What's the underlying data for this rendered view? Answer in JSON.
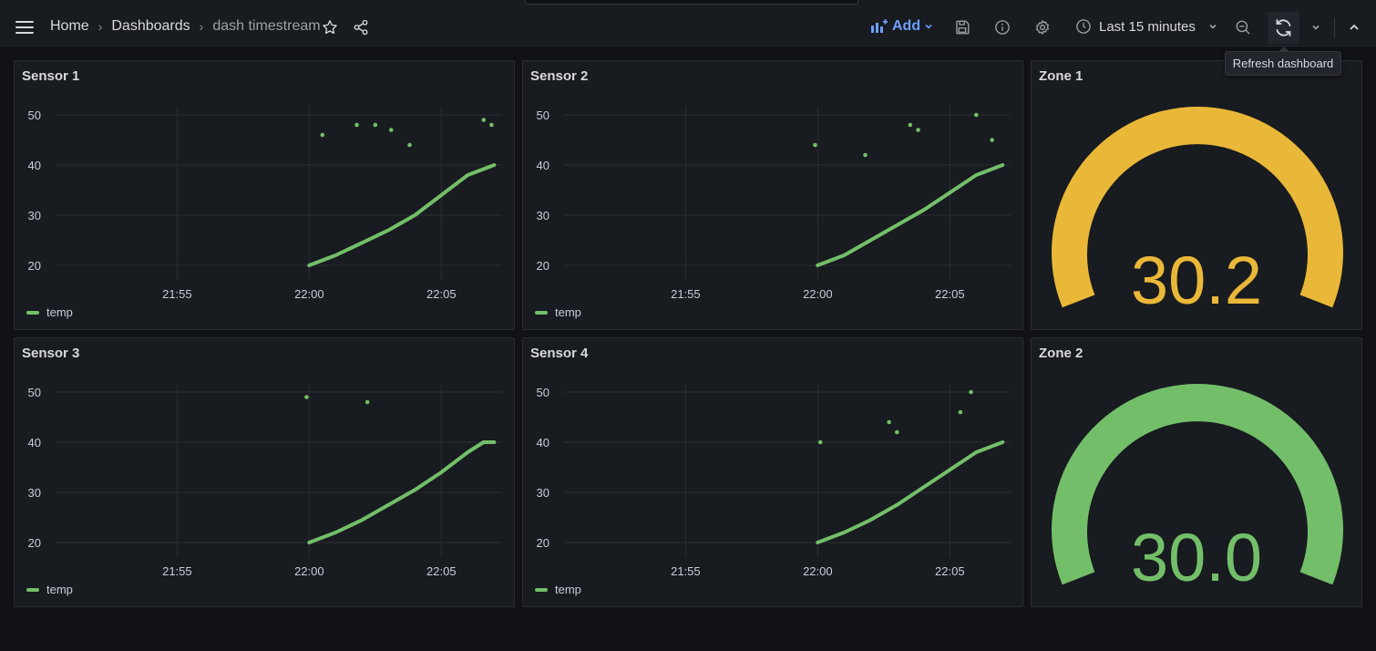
{
  "breadcrumbs": [
    "Home",
    "Dashboards",
    "dash timestream"
  ],
  "toolbar": {
    "add_label": "Add",
    "time_range": "Last 15 minutes",
    "refresh_tooltip": "Refresh dashboard"
  },
  "colors": {
    "series": "#73bf69",
    "gauge_zone1": "#eab839",
    "gauge_zone2": "#73bf69",
    "accent": "#6e9fff"
  },
  "icons": [
    "menu-icon",
    "star-icon",
    "share-icon",
    "add-panel-icon",
    "save-icon",
    "info-icon",
    "gear-icon",
    "clock-icon",
    "chevron-down-icon",
    "zoom-out-icon",
    "refresh-icon",
    "collapse-icon"
  ],
  "panels": [
    {
      "title": "Sensor 1",
      "legend": "temp"
    },
    {
      "title": "Sensor 2",
      "legend": "temp"
    },
    {
      "title": "Sensor 3",
      "legend": "temp"
    },
    {
      "title": "Sensor 4",
      "legend": "temp"
    }
  ],
  "gauges": [
    {
      "title": "Zone 1",
      "value": "30.2",
      "color": "#eab839"
    },
    {
      "title": "Zone 2",
      "value": "30.0",
      "color": "#73bf69"
    }
  ],
  "chart_data": [
    {
      "type": "scatter",
      "title": "Sensor 1",
      "series": [
        {
          "name": "temp",
          "line": [
            [
              "22:00",
              20
            ],
            [
              "22:01",
              22
            ],
            [
              "22:02",
              24.5
            ],
            [
              "22:03",
              27
            ],
            [
              "22:04",
              30
            ],
            [
              "22:05",
              34
            ],
            [
              "22:06",
              38
            ],
            [
              "22:07",
              40
            ]
          ],
          "points": [
            [
              "22:00.5",
              46
            ],
            [
              "22:01.8",
              48
            ],
            [
              "22:02.5",
              48
            ],
            [
              "22:03.1",
              47
            ],
            [
              "22:03.8",
              44
            ],
            [
              "22:06.6",
              49
            ],
            [
              "22:06.9",
              48
            ]
          ]
        }
      ],
      "x_ticks": [
        "21:55",
        "22:00",
        "22:05"
      ],
      "y_ticks": [
        20,
        30,
        40,
        50
      ],
      "ylim": [
        20,
        50
      ]
    },
    {
      "type": "scatter",
      "title": "Sensor 2",
      "series": [
        {
          "name": "temp",
          "line": [
            [
              "22:00",
              20
            ],
            [
              "22:01",
              22
            ],
            [
              "22:02",
              25
            ],
            [
              "22:03",
              28
            ],
            [
              "22:04",
              31
            ],
            [
              "22:05",
              34.5
            ],
            [
              "22:06",
              38
            ],
            [
              "22:07",
              40
            ]
          ],
          "points": [
            [
              "21:59.9",
              44
            ],
            [
              "22:01.8",
              42
            ],
            [
              "22:03.5",
              48
            ],
            [
              "22:03.8",
              47
            ],
            [
              "22:06",
              50
            ],
            [
              "22:06.6",
              45
            ]
          ]
        }
      ],
      "x_ticks": [
        "21:55",
        "22:00",
        "22:05"
      ],
      "y_ticks": [
        20,
        30,
        40,
        50
      ],
      "ylim": [
        20,
        50
      ]
    },
    {
      "type": "scatter",
      "title": "Sensor 3",
      "series": [
        {
          "name": "temp",
          "line": [
            [
              "22:00",
              20
            ],
            [
              "22:01",
              22
            ],
            [
              "22:02",
              24.5
            ],
            [
              "22:03",
              27.5
            ],
            [
              "22:04",
              30.5
            ],
            [
              "22:05",
              34
            ],
            [
              "22:06",
              38
            ],
            [
              "22:06.6",
              40
            ],
            [
              "22:07",
              40
            ]
          ],
          "points": [
            [
              "21:59.9",
              49
            ],
            [
              "22:02.2",
              48
            ]
          ]
        }
      ],
      "x_ticks": [
        "21:55",
        "22:00",
        "22:05"
      ],
      "y_ticks": [
        20,
        30,
        40,
        50
      ],
      "ylim": [
        20,
        50
      ]
    },
    {
      "type": "scatter",
      "title": "Sensor 4",
      "series": [
        {
          "name": "temp",
          "line": [
            [
              "22:00",
              20
            ],
            [
              "22:01",
              22
            ],
            [
              "22:02",
              24.5
            ],
            [
              "22:03",
              27.5
            ],
            [
              "22:04",
              31
            ],
            [
              "22:05",
              34.5
            ],
            [
              "22:06",
              38
            ],
            [
              "22:07",
              40
            ]
          ],
          "points": [
            [
              "22:00.1",
              40
            ],
            [
              "22:02.7",
              44
            ],
            [
              "22:03",
              42
            ],
            [
              "22:05.4",
              46
            ],
            [
              "22:05.8",
              50
            ]
          ]
        }
      ],
      "x_ticks": [
        "21:55",
        "22:00",
        "22:05"
      ],
      "y_ticks": [
        20,
        30,
        40,
        50
      ],
      "ylim": [
        20,
        50
      ]
    }
  ]
}
